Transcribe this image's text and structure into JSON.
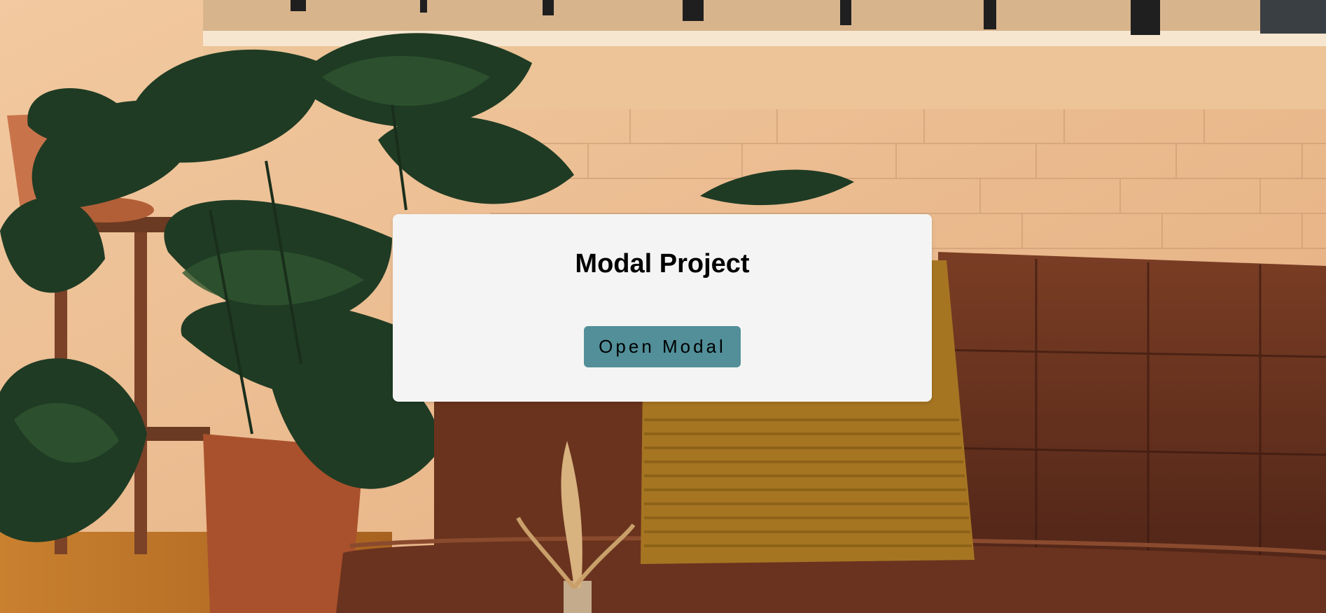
{
  "modal": {
    "title": "Modal Project",
    "open_button_label": "Open Modal"
  },
  "colors": {
    "card_background": "#f4f4f4",
    "button_background": "#528f99",
    "title_text": "#000000"
  },
  "background": {
    "description_icon": "living-room-photo"
  }
}
